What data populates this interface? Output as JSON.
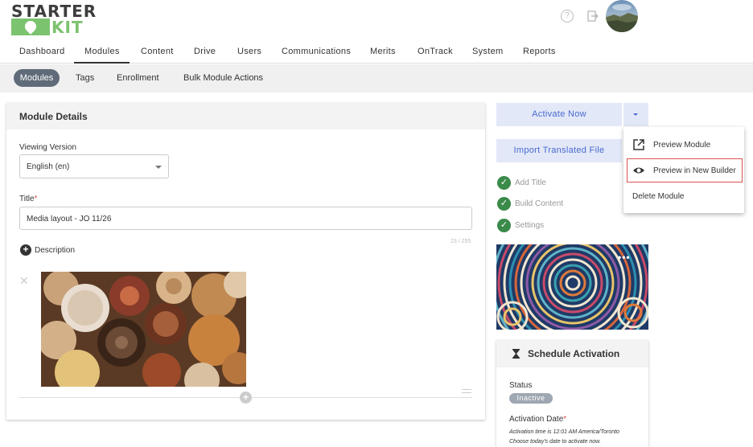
{
  "header": {
    "logo_top": "STARTER",
    "logo_bottom": "KIT",
    "help_icon": "help-circle-icon",
    "logout_icon": "logout-icon"
  },
  "main_nav": {
    "items": [
      "Dashboard",
      "Modules",
      "Content",
      "Drive",
      "Users",
      "Communications",
      "Merits",
      "OnTrack",
      "System",
      "Reports"
    ],
    "active": "Modules"
  },
  "sub_nav": {
    "items": [
      "Modules",
      "Tags",
      "Enrollment",
      "Bulk Module Actions"
    ],
    "active": "Modules"
  },
  "module_details": {
    "title": "Module Details",
    "viewing_version_label": "Viewing Version",
    "viewing_version_value": "English (en)",
    "title_label": "Title",
    "required_mark": "*",
    "title_value": "Media layout - JO 11/26",
    "char_counter": "23 / 255",
    "description_label": "Description"
  },
  "actions": {
    "activate_now": "Activate Now",
    "import_translated": "Import Translated File"
  },
  "checklist": [
    "Add Title",
    "Build Content",
    "Settings"
  ],
  "dropdown_menu": {
    "items": [
      {
        "label": "Preview Module",
        "icon": "external-link-icon"
      },
      {
        "label": "Preview in New Builder",
        "icon": "eye-icon"
      },
      {
        "label": "Delete Module",
        "icon": ""
      }
    ],
    "highlighted": "Preview in New Builder"
  },
  "schedule": {
    "title": "Schedule Activation",
    "status_label": "Status",
    "status_value": "Inactive",
    "activation_date_label": "Activation Date",
    "required_mark": "*",
    "note_line1": "Activation time is 12:01 AM America/Toronto",
    "note_line2": "Choose today's date to activate now."
  },
  "colors": {
    "brand_green": "#7cc36f",
    "accent_blue": "#4a6ad0",
    "button_bg": "#e2e8f7",
    "check_green": "#3a8a4a",
    "highlight_red": "#d9534f"
  }
}
